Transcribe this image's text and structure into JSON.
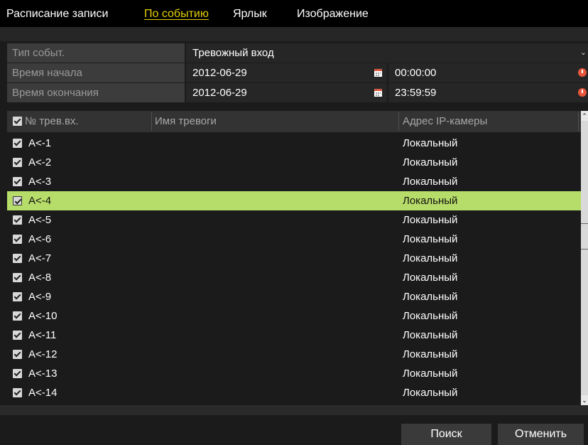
{
  "tabs": [
    {
      "label": "Расписание записи"
    },
    {
      "label": "По событию"
    },
    {
      "label": "Ярлык"
    },
    {
      "label": "Изображение"
    }
  ],
  "active_tab": "По событию",
  "filters": {
    "event_type": {
      "label": "Тип событ.",
      "value": "Тревожный вход"
    },
    "start": {
      "label": "Время начала",
      "date": "2012-06-29",
      "time": "00:00:00"
    },
    "end": {
      "label": "Время окончания",
      "date": "2012-06-29",
      "time": "23:59:59"
    }
  },
  "table": {
    "headers": {
      "alarm_no": "№ трев.вх.",
      "alarm_name": "Имя тревоги",
      "camera_ip": "Адрес IP-камеры"
    },
    "selected_index": 3,
    "rows": [
      {
        "id": "A<-1",
        "name": "",
        "address": "Локальный",
        "checked": true
      },
      {
        "id": "A<-2",
        "name": "",
        "address": "Локальный",
        "checked": true
      },
      {
        "id": "A<-3",
        "name": "",
        "address": "Локальный",
        "checked": true
      },
      {
        "id": "A<-4",
        "name": "",
        "address": "Локальный",
        "checked": true
      },
      {
        "id": "A<-5",
        "name": "",
        "address": "Локальный",
        "checked": true
      },
      {
        "id": "A<-6",
        "name": "",
        "address": "Локальный",
        "checked": true
      },
      {
        "id": "A<-7",
        "name": "",
        "address": "Локальный",
        "checked": true
      },
      {
        "id": "A<-8",
        "name": "",
        "address": "Локальный",
        "checked": true
      },
      {
        "id": "A<-9",
        "name": "",
        "address": "Локальный",
        "checked": true
      },
      {
        "id": "A<-10",
        "name": "",
        "address": "Локальный",
        "checked": true
      },
      {
        "id": "A<-11",
        "name": "",
        "address": "Локальный",
        "checked": true
      },
      {
        "id": "A<-12",
        "name": "",
        "address": "Локальный",
        "checked": true
      },
      {
        "id": "A<-13",
        "name": "",
        "address": "Локальный",
        "checked": true
      },
      {
        "id": "A<-14",
        "name": "",
        "address": "Локальный",
        "checked": true
      }
    ]
  },
  "buttons": {
    "search": "Поиск",
    "cancel": "Отменить"
  },
  "colors": {
    "active_tab": "#e3d100",
    "selected_row": "#b6dc6a",
    "calendar_icon": "#e8573c",
    "clock_icon": "#e8573c"
  }
}
